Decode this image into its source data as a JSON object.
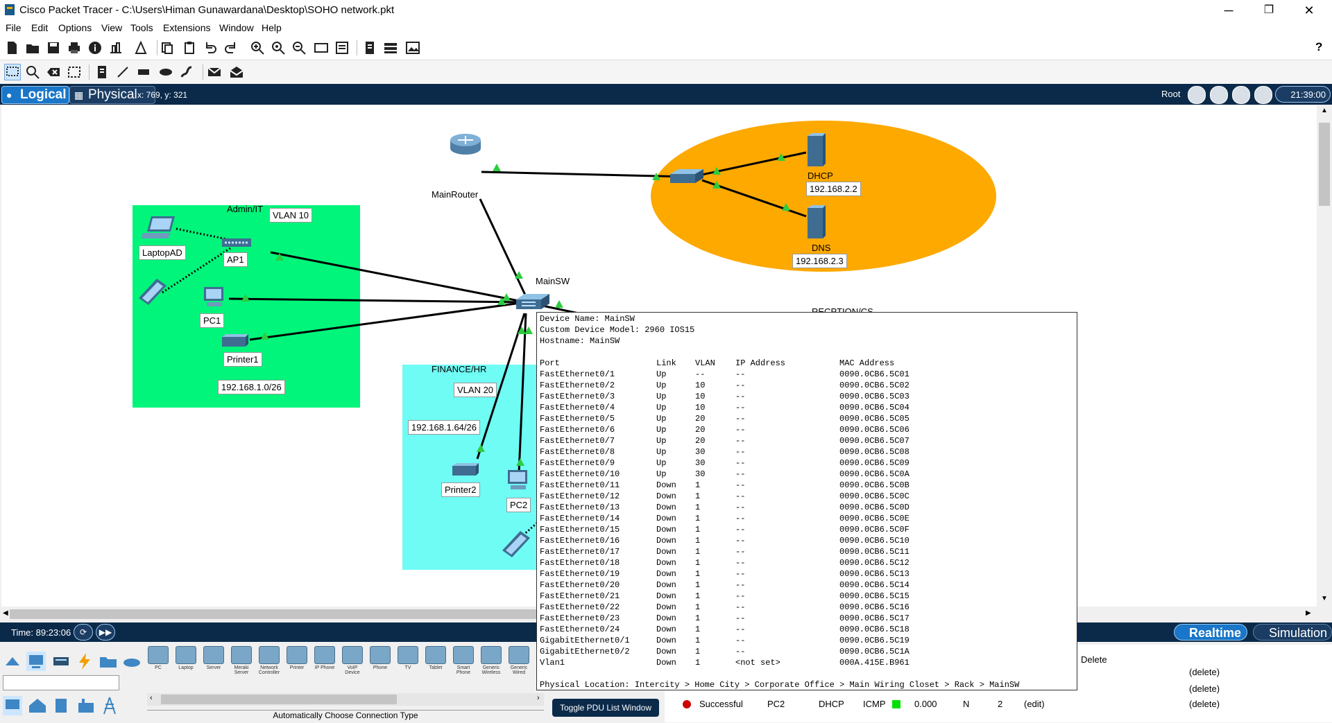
{
  "window": {
    "title": "Cisco Packet Tracer - C:\\Users\\Himan Gunawardana\\Desktop\\SOHO network.pkt",
    "minimize": "─",
    "restore": "❐",
    "close": "✕"
  },
  "menu": {
    "items": [
      "File",
      "Edit",
      "Options",
      "View",
      "Tools",
      "Extensions",
      "Window",
      "Help"
    ]
  },
  "toolbar": {
    "help": "?"
  },
  "navbar": {
    "logical": "Logical",
    "physical": "Physical",
    "coords": "x: 769, y: 321",
    "root": "Root",
    "clock": "21:39:00"
  },
  "topology": {
    "zones": {
      "admin_title": "Admin/IT",
      "admin_vlan": "VLAN 10",
      "admin_net": "192.168.1.0/26",
      "finance_title": "FINANCE/HR",
      "finance_vlan": "VLAN 20",
      "finance_net": "192.168.1.64/26",
      "reception_title": "RECPTION/CS"
    },
    "devices": {
      "main_router": "MainRouter",
      "main_sw": "MainSW",
      "laptop": "LaptopAD",
      "ap1": "AP1",
      "pc1": "PC1",
      "printer1": "Printer1",
      "printer2": "Printer2",
      "pc2": "PC2",
      "dhcp": "DHCP",
      "dhcp_ip": "192.168.2.2",
      "dns": "DNS",
      "dns_ip": "192.168.2.3"
    },
    "colors": {
      "admin_zone": "#00f57a",
      "finance_zone": "#6ffcf5",
      "server_zone": "#fda900",
      "link_up": "#2ecc40"
    }
  },
  "device_info": {
    "device_name": "Device Name: MainSW",
    "custom_model": "Custom Device Model: 2960 IOS15",
    "hostname": "Hostname: MainSW",
    "headers": {
      "port": "Port",
      "link": "Link",
      "vlan": "VLAN",
      "ip": "IP Address",
      "mac": "MAC Address"
    },
    "ports": [
      {
        "port": "FastEthernet0/1",
        "link": "Up",
        "vlan": "--",
        "ip": "--",
        "mac": "0090.0CB6.5C01"
      },
      {
        "port": "FastEthernet0/2",
        "link": "Up",
        "vlan": "10",
        "ip": "--",
        "mac": "0090.0CB6.5C02"
      },
      {
        "port": "FastEthernet0/3",
        "link": "Up",
        "vlan": "10",
        "ip": "--",
        "mac": "0090.0CB6.5C03"
      },
      {
        "port": "FastEthernet0/4",
        "link": "Up",
        "vlan": "10",
        "ip": "--",
        "mac": "0090.0CB6.5C04"
      },
      {
        "port": "FastEthernet0/5",
        "link": "Up",
        "vlan": "20",
        "ip": "--",
        "mac": "0090.0CB6.5C05"
      },
      {
        "port": "FastEthernet0/6",
        "link": "Up",
        "vlan": "20",
        "ip": "--",
        "mac": "0090.0CB6.5C06"
      },
      {
        "port": "FastEthernet0/7",
        "link": "Up",
        "vlan": "20",
        "ip": "--",
        "mac": "0090.0CB6.5C07"
      },
      {
        "port": "FastEthernet0/8",
        "link": "Up",
        "vlan": "30",
        "ip": "--",
        "mac": "0090.0CB6.5C08"
      },
      {
        "port": "FastEthernet0/9",
        "link": "Up",
        "vlan": "30",
        "ip": "--",
        "mac": "0090.0CB6.5C09"
      },
      {
        "port": "FastEthernet0/10",
        "link": "Up",
        "vlan": "30",
        "ip": "--",
        "mac": "0090.0CB6.5C0A"
      },
      {
        "port": "FastEthernet0/11",
        "link": "Down",
        "vlan": "1",
        "ip": "--",
        "mac": "0090.0CB6.5C0B"
      },
      {
        "port": "FastEthernet0/12",
        "link": "Down",
        "vlan": "1",
        "ip": "--",
        "mac": "0090.0CB6.5C0C"
      },
      {
        "port": "FastEthernet0/13",
        "link": "Down",
        "vlan": "1",
        "ip": "--",
        "mac": "0090.0CB6.5C0D"
      },
      {
        "port": "FastEthernet0/14",
        "link": "Down",
        "vlan": "1",
        "ip": "--",
        "mac": "0090.0CB6.5C0E"
      },
      {
        "port": "FastEthernet0/15",
        "link": "Down",
        "vlan": "1",
        "ip": "--",
        "mac": "0090.0CB6.5C0F"
      },
      {
        "port": "FastEthernet0/16",
        "link": "Down",
        "vlan": "1",
        "ip": "--",
        "mac": "0090.0CB6.5C10"
      },
      {
        "port": "FastEthernet0/17",
        "link": "Down",
        "vlan": "1",
        "ip": "--",
        "mac": "0090.0CB6.5C11"
      },
      {
        "port": "FastEthernet0/18",
        "link": "Down",
        "vlan": "1",
        "ip": "--",
        "mac": "0090.0CB6.5C12"
      },
      {
        "port": "FastEthernet0/19",
        "link": "Down",
        "vlan": "1",
        "ip": "--",
        "mac": "0090.0CB6.5C13"
      },
      {
        "port": "FastEthernet0/20",
        "link": "Down",
        "vlan": "1",
        "ip": "--",
        "mac": "0090.0CB6.5C14"
      },
      {
        "port": "FastEthernet0/21",
        "link": "Down",
        "vlan": "1",
        "ip": "--",
        "mac": "0090.0CB6.5C15"
      },
      {
        "port": "FastEthernet0/22",
        "link": "Down",
        "vlan": "1",
        "ip": "--",
        "mac": "0090.0CB6.5C16"
      },
      {
        "port": "FastEthernet0/23",
        "link": "Down",
        "vlan": "1",
        "ip": "--",
        "mac": "0090.0CB6.5C17"
      },
      {
        "port": "FastEthernet0/24",
        "link": "Down",
        "vlan": "1",
        "ip": "--",
        "mac": "0090.0CB6.5C18"
      },
      {
        "port": "GigabitEthernet0/1",
        "link": "Down",
        "vlan": "1",
        "ip": "--",
        "mac": "0090.0CB6.5C19"
      },
      {
        "port": "GigabitEthernet0/2",
        "link": "Down",
        "vlan": "1",
        "ip": "--",
        "mac": "0090.0CB6.5C1A"
      },
      {
        "port": "Vlan1",
        "link": "Down",
        "vlan": "1",
        "ip": "<not set>",
        "mac": "000A.415E.B961"
      }
    ],
    "physical_location": "Physical Location: Intercity > Home City > Corporate Office > Main Wiring Closet > Rack > MainSW"
  },
  "timebar": {
    "time": "Time: 89:23:06",
    "realtime": "Realtime",
    "simulation": "Simulation"
  },
  "device_types": [
    "PC",
    "Laptop",
    "Server",
    "Meraki Server",
    "Network Controller",
    "Printer",
    "IP Phone",
    "VoIP Device",
    "Phone",
    "TV",
    "Tablet",
    "Smart Phone",
    "Generic Wireless",
    "Generic Wired"
  ],
  "connection_type": "Automatically Choose Connection Type",
  "pdu": {
    "toggle": "Toggle PDU List Window",
    "delete_header": "Delete",
    "delete_rows": [
      "(delete)",
      "(delete)",
      "(delete)"
    ],
    "row": {
      "status": "Successful",
      "source": "PC2",
      "destination": "DHCP",
      "type": "ICMP",
      "time": "0.000",
      "periodic": "N",
      "num": "2",
      "edit": "(edit)"
    }
  }
}
